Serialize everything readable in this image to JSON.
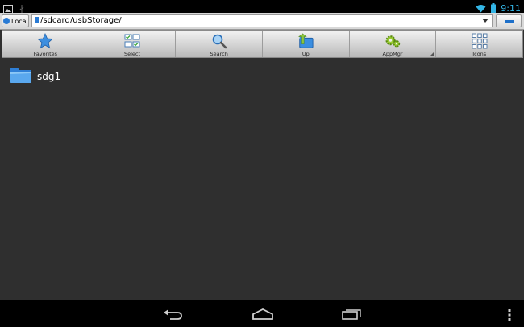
{
  "status_bar": {
    "time": "9:11",
    "left_icons": [
      "image-icon",
      "usb-icon"
    ],
    "right_icons": [
      "wifi-icon",
      "battery-icon"
    ]
  },
  "address_bar": {
    "location_button": "Local",
    "path": "/sdcard/usbStorage/"
  },
  "toolbar": {
    "buttons": [
      {
        "label": "Favorites",
        "icon": "star-icon"
      },
      {
        "label": "Select",
        "icon": "select-grid-icon"
      },
      {
        "label": "Search",
        "icon": "magnifier-icon"
      },
      {
        "label": "Up",
        "icon": "folder-up-icon"
      },
      {
        "label": "AppMgr",
        "icon": "gears-icon"
      },
      {
        "label": "Icons",
        "icon": "icons-grid-icon"
      }
    ]
  },
  "files": [
    {
      "name": "sdg1",
      "type": "folder"
    }
  ],
  "nav_bar": {
    "icons": [
      "back-icon",
      "home-icon",
      "recent-apps-icon",
      "overflow-menu-icon"
    ]
  },
  "colors": {
    "background": "#2f2f2f",
    "accent": "#33b5e5",
    "folder_blue": "#3a8ee0"
  }
}
